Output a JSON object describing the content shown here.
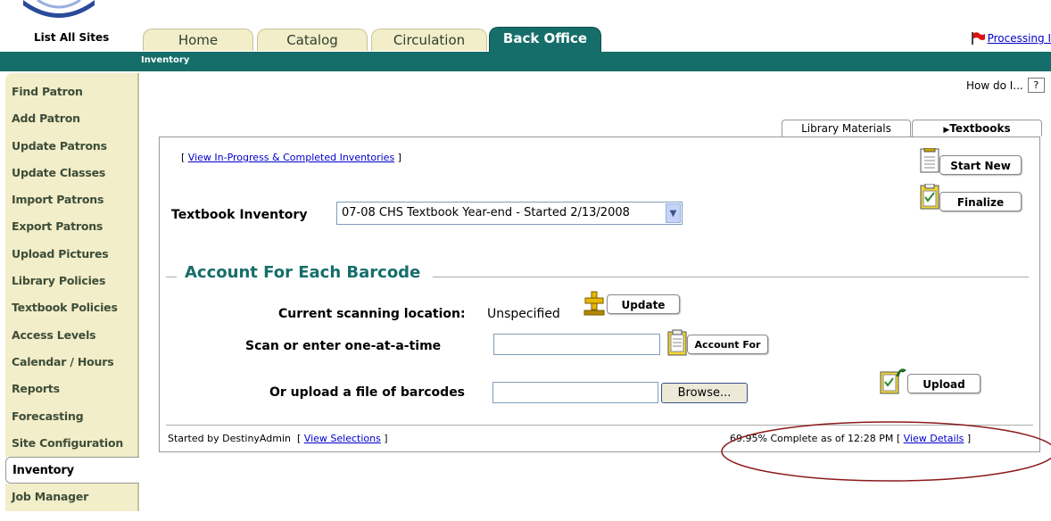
{
  "header": {
    "list_sites": "List All Sites",
    "tabs": [
      {
        "label": "Home"
      },
      {
        "label": "Catalog"
      },
      {
        "label": "Circulation"
      },
      {
        "label": "Back Office"
      }
    ],
    "processing_link": "Processing I",
    "breadcrumb": "Inventory"
  },
  "sidebar": {
    "items": [
      {
        "label": "Find Patron"
      },
      {
        "label": "Add Patron"
      },
      {
        "label": "Update Patrons"
      },
      {
        "label": "Update Classes"
      },
      {
        "label": "Import Patrons"
      },
      {
        "label": "Export Patrons"
      },
      {
        "label": "Upload Pictures"
      },
      {
        "label": "Library Policies"
      },
      {
        "label": "Textbook Policies"
      },
      {
        "label": "Access Levels"
      },
      {
        "label": "Calendar / Hours"
      },
      {
        "label": "Reports"
      },
      {
        "label": "Forecasting"
      },
      {
        "label": "Site Configuration"
      },
      {
        "label": "Inventory"
      },
      {
        "label": "Job Manager"
      }
    ]
  },
  "help": {
    "how_do_i": "How do I...",
    "help_button": "?"
  },
  "subtabs": {
    "library_materials": "Library Materials",
    "textbooks": "Textbooks",
    "textbooks_marker": "▶"
  },
  "main": {
    "view_inprogress_open": "[ ",
    "view_inprogress_link": "View In-Progress & Completed Inventories",
    "view_inprogress_close": " ]",
    "start_new_label": "Start New",
    "finalize_label": "Finalize",
    "inventory_label": "Textbook Inventory",
    "inventory_selected": "07-08 CHS Textbook Year-end - Started 2/13/2008",
    "section_title": "Account For Each Barcode",
    "location_label": "Current scanning location:",
    "location_value": "Unspecified",
    "update_label": "Update",
    "scan_label": "Scan or enter one-at-a-time",
    "scan_value": "",
    "account_for_label": "Account For",
    "upload_file_label": "Or upload a file of barcodes",
    "file_value": "",
    "browse_label": "Browse...",
    "upload_label": "Upload"
  },
  "footer": {
    "started_by": "Started by DestinyAdmin",
    "view_selections_open": "[ ",
    "view_selections_link": "View Selections",
    "view_selections_close": " ]",
    "complete_text": "69.95% Complete as of 12:28 PM",
    "view_details_open": "[ ",
    "view_details_link": "View Details",
    "view_details_close": " ]"
  },
  "colors": {
    "brand_teal": "#156e6a",
    "tab_cream": "#f2eec9",
    "link_blue": "#0000cc",
    "annotation_oval": "#8b1a1a"
  }
}
